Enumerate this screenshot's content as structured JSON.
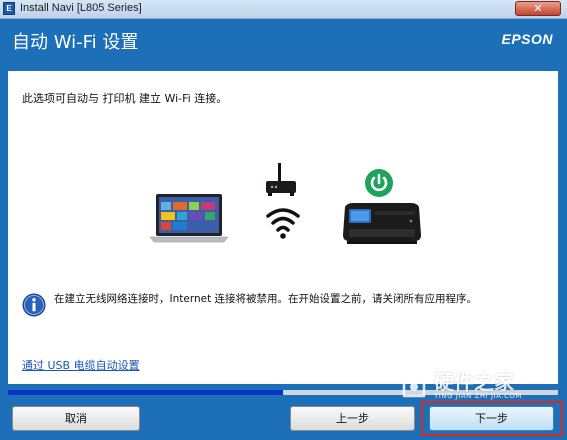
{
  "window": {
    "title": "Install Navi [L805 Series]",
    "close_glyph": "✕"
  },
  "header": {
    "title": "自动 Wi-Fi 设置",
    "logo": "EPSON"
  },
  "main": {
    "intro": "此选项可自动与 打印机 建立 Wi-Fi 连接。",
    "notice": "在建立无线网络连接时，Internet 连接将被禁用。在开始设置之前，请关闭所有应用程序。",
    "usb_link": "通过 USB 电缆自动设置",
    "illustration": {
      "icons": [
        "laptop-icon",
        "router-icon",
        "wifi-icon",
        "power-icon",
        "printer-icon"
      ],
      "power_color": "#1ea35a"
    }
  },
  "progress": {
    "percent": 50,
    "color": "#0a35c4"
  },
  "buttons": {
    "cancel": "取消",
    "back": "上一步",
    "next": "下一步"
  },
  "watermark": {
    "text": "硬件之家",
    "url": "YING JIAN ZHI JIA.COM"
  },
  "colors": {
    "accent": "#1d6fb8",
    "highlight": "#e0271d"
  }
}
